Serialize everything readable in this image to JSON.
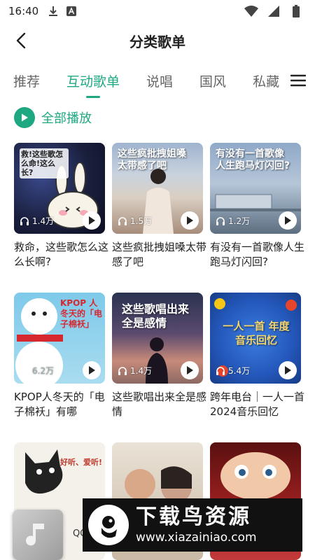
{
  "status_bar": {
    "time": "16:40",
    "icons": [
      "download-icon",
      "a-badge-icon",
      "wifi-icon",
      "signal-icon",
      "battery-icon"
    ]
  },
  "header": {
    "title": "分类歌单",
    "back_icon": "chevron-left-icon"
  },
  "tabs": [
    {
      "label": "推荐",
      "active": false
    },
    {
      "label": "互动歌单",
      "active": true
    },
    {
      "label": "说唱",
      "active": false
    },
    {
      "label": "国风",
      "active": false
    },
    {
      "label": "私藏",
      "active": false
    }
  ],
  "menu_icon": "hamburger-icon",
  "play_all": {
    "label": "全部播放",
    "icon": "play-circle-icon"
  },
  "playlists": [
    {
      "name": "救命，这些歌怎么这么长啊?",
      "plays": "1.4万",
      "cover_text": "救!这些歌怎么命!这么长?"
    },
    {
      "name": "这些疯批拽姐嗓太带感了吧",
      "plays": "1.5万",
      "cover_text": "这些疯批拽姐嗓太带感了吧"
    },
    {
      "name": "有没有一首歌像人生跑马灯闪回?",
      "plays": "1.2万",
      "cover_text": "有没有一首歌像人生跑马灯闪回?"
    },
    {
      "name": "KPOP人冬天的「电子棉袄」有哪",
      "plays": "6.2万",
      "cover_text": "KPOP 人冬天的「电子棉袄」"
    },
    {
      "name": "这些歌唱出来全是感情",
      "plays": "1.4万",
      "cover_text": "这些歌唱出来全是感情"
    },
    {
      "name": "跨年电台｜一人一首2024音乐回忆",
      "plays": "5.4万",
      "cover_text": "一人一首 年度音乐回忆"
    },
    {
      "name": "",
      "plays": "",
      "cover_text": "好听、爱听!"
    },
    {
      "name": "",
      "plays": "",
      "cover_text": ""
    },
    {
      "name": "",
      "plays": "",
      "cover_text": ""
    }
  ],
  "mini_player": {
    "label": "QQ",
    "icon": "music-note-icon"
  },
  "watermark": {
    "title": "下载鸟资源",
    "url": "www.xiazainiao.com"
  },
  "colors": {
    "accent": "#1ea882",
    "text": "#222222",
    "tab_inactive": "#666666"
  }
}
